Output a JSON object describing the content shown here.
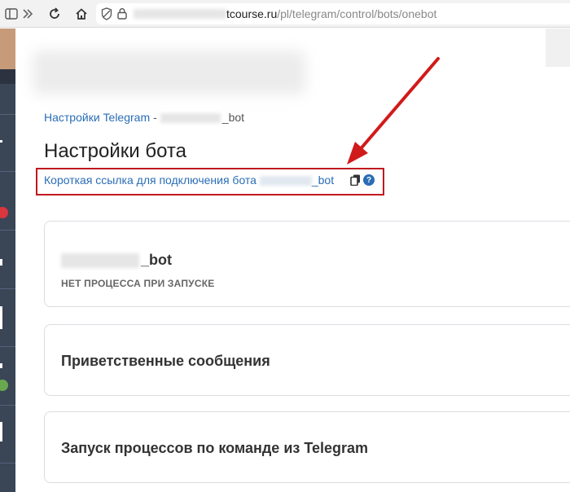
{
  "browser": {
    "url_domain": "tcourse.ru",
    "url_path": "/pl/telegram/control/bots/onebot",
    "icons": [
      "sidebar-toggle-icon",
      "forward-icon",
      "reload-icon",
      "home-icon",
      "tracking-shield-icon",
      "lock-icon"
    ]
  },
  "breadcrumb": {
    "link": "Настройки Telegram",
    "separator": "-",
    "bot_suffix": "_bot"
  },
  "page": {
    "title": "Настройки бота",
    "shortlink_text": "Короткая ссылка для подключения бота",
    "shortlink_suffix": "_bot"
  },
  "cards": {
    "bot": {
      "name_suffix": "_bot",
      "status": "НЕТ ПРОЦЕССА ПРИ ЗАПУСКЕ"
    },
    "welcome": {
      "title": "Приветственные сообщения"
    },
    "commands": {
      "title": "Запуск процессов по команде из Telegram"
    }
  },
  "colors": {
    "link": "#2a6db5",
    "highlight_border": "#c0191f",
    "arrow": "#d11a1a",
    "sidebar": "#3a4556"
  }
}
